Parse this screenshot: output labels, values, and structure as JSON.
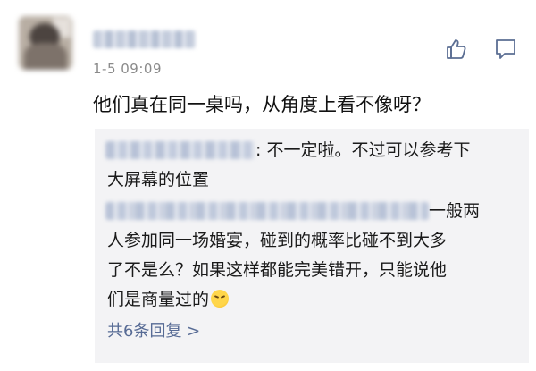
{
  "comment": {
    "avatar_icon": "user-avatar-icon",
    "timestamp": "1-5 09:09",
    "text": "他们真在同一桌吗，从角度上看不像呀？",
    "actions": {
      "like_icon": "thumbs-up-icon",
      "comment_icon": "comment-bubble-icon"
    }
  },
  "reply": {
    "line1": ": 不一定啦。不过可以参考下",
    "line2": "大屏幕的位置",
    "line3": "一般两",
    "line4": "人参加同一场婚宴，碰到的概率比碰不到大多",
    "line5": "了不是么？如果这样都能完美错开，只能说他",
    "line6": "们是商量过的",
    "emoji_icon": "grimace-emoji-icon",
    "view_all": "共6条回复 >"
  },
  "colors": {
    "link": "#576b95",
    "timestamp": "#8a8a8a",
    "reply_bg": "#f3f3f5",
    "icon": "#5b6e93"
  }
}
